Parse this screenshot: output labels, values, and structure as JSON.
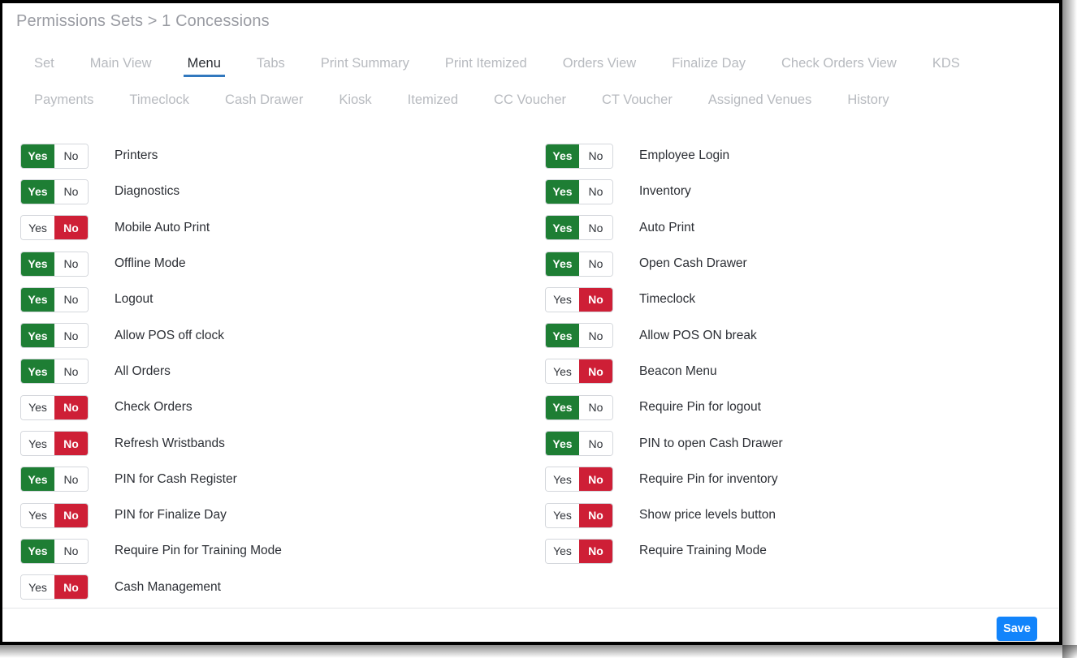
{
  "breadcrumb": {
    "text": "Permissions Sets > 1 Concessions"
  },
  "tabs": {
    "active": "Menu",
    "items": [
      {
        "label": "Set"
      },
      {
        "label": "Main View"
      },
      {
        "label": "Menu"
      },
      {
        "label": "Tabs"
      },
      {
        "label": "Print Summary"
      },
      {
        "label": "Print Itemized"
      },
      {
        "label": "Orders View"
      },
      {
        "label": "Finalize Day"
      },
      {
        "label": "Check Orders View"
      },
      {
        "label": "KDS"
      },
      {
        "label": "Payments"
      },
      {
        "label": "Timeclock"
      },
      {
        "label": "Cash Drawer"
      },
      {
        "label": "Kiosk"
      },
      {
        "label": "Itemized"
      },
      {
        "label": "CC Voucher"
      },
      {
        "label": "CT Voucher"
      },
      {
        "label": "Assigned Venues"
      },
      {
        "label": "History"
      }
    ]
  },
  "toggle": {
    "yes_label": "Yes",
    "no_label": "No"
  },
  "permissions": {
    "left_column": [
      {
        "label": "Printers",
        "value": "Yes"
      },
      {
        "label": "Diagnostics",
        "value": "Yes"
      },
      {
        "label": "Mobile Auto Print",
        "value": "No"
      },
      {
        "label": "Offline Mode",
        "value": "Yes"
      },
      {
        "label": "Logout",
        "value": "Yes"
      },
      {
        "label": "Allow POS off clock",
        "value": "Yes"
      },
      {
        "label": "All Orders",
        "value": "Yes"
      },
      {
        "label": "Check Orders",
        "value": "No"
      },
      {
        "label": "Refresh Wristbands",
        "value": "No"
      },
      {
        "label": "PIN for Cash Register",
        "value": "Yes"
      },
      {
        "label": "PIN for Finalize Day",
        "value": "No"
      },
      {
        "label": "Require Pin for Training Mode",
        "value": "Yes"
      },
      {
        "label": "Cash Management",
        "value": "No"
      }
    ],
    "right_column": [
      {
        "label": "Employee Login",
        "value": "Yes"
      },
      {
        "label": "Inventory",
        "value": "Yes"
      },
      {
        "label": "Auto Print",
        "value": "Yes"
      },
      {
        "label": "Open Cash Drawer",
        "value": "Yes"
      },
      {
        "label": "Timeclock",
        "value": "No"
      },
      {
        "label": "Allow POS ON break",
        "value": "Yes"
      },
      {
        "label": "Beacon Menu",
        "value": "No"
      },
      {
        "label": "Require Pin for logout",
        "value": "Yes"
      },
      {
        "label": "PIN to open Cash Drawer",
        "value": "Yes"
      },
      {
        "label": "Require Pin for inventory",
        "value": "No"
      },
      {
        "label": "Show price levels button",
        "value": "No"
      },
      {
        "label": "Require Training Mode",
        "value": "No"
      }
    ]
  },
  "footer": {
    "save_label": "Save"
  },
  "colors": {
    "yes_green": "#1e7e34",
    "no_red": "#ce1f36",
    "save_blue": "#1284fb",
    "active_tab_underline": "#3178be",
    "tab_inactive_text": "#b7babf",
    "breadcrumb_text": "#9a9ca3"
  }
}
